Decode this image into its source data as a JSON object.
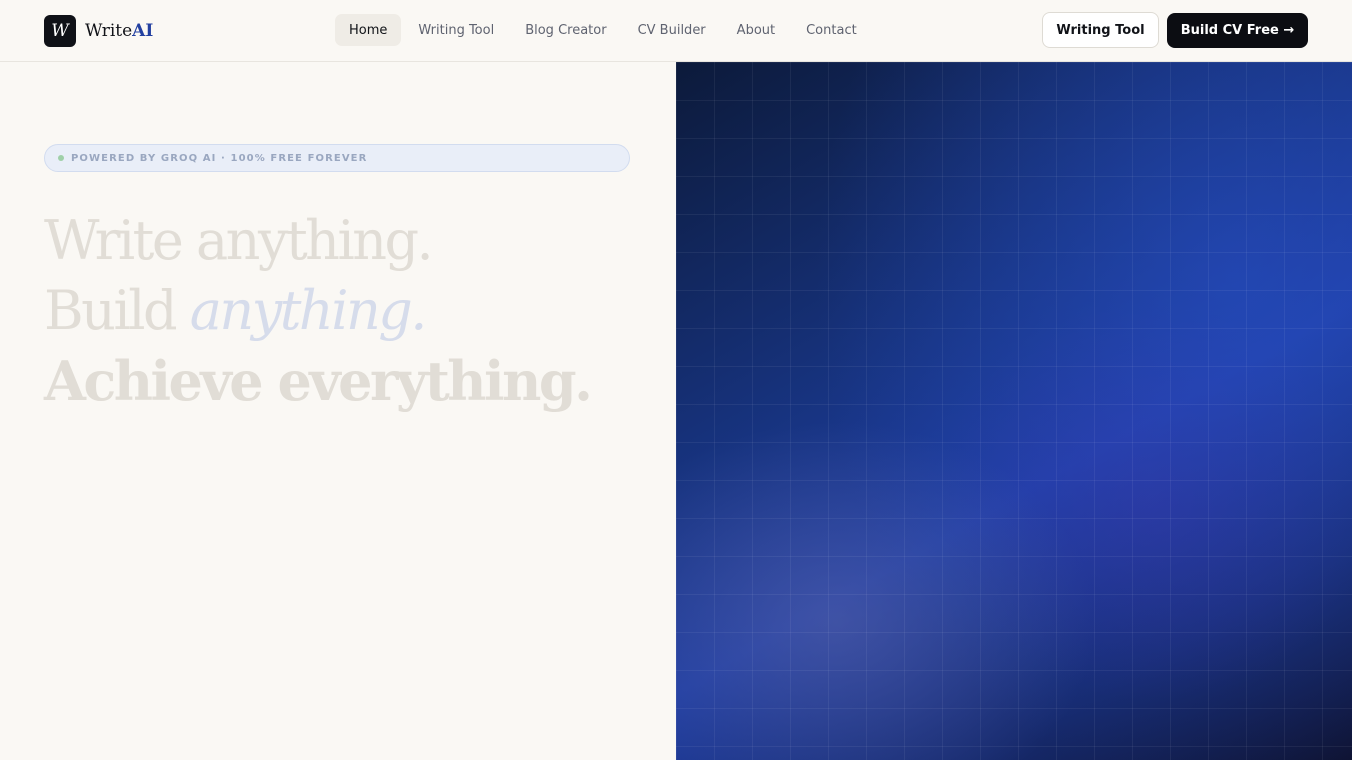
{
  "brand": {
    "mark": "W",
    "name_prefix": "Write",
    "name_accent": "AI"
  },
  "nav": {
    "items": [
      {
        "label": "Home",
        "active": true
      },
      {
        "label": "Writing Tool",
        "active": false
      },
      {
        "label": "Blog Creator",
        "active": false
      },
      {
        "label": "CV Builder",
        "active": false
      },
      {
        "label": "About",
        "active": false
      },
      {
        "label": "Contact",
        "active": false
      }
    ]
  },
  "actions": {
    "secondary_label": "Writing Tool",
    "primary_label": "Build CV Free →"
  },
  "hero": {
    "badge": "POWERED BY GROQ AI · 100% FREE FOREVER",
    "line1": "Write anything.",
    "line2_prefix": "Build ",
    "line2_emphasis": "anything.",
    "line3": "Achieve everything."
  },
  "colors": {
    "accent": "#2340a0",
    "dark": "#0c0d12",
    "background": "#faf8f4"
  }
}
